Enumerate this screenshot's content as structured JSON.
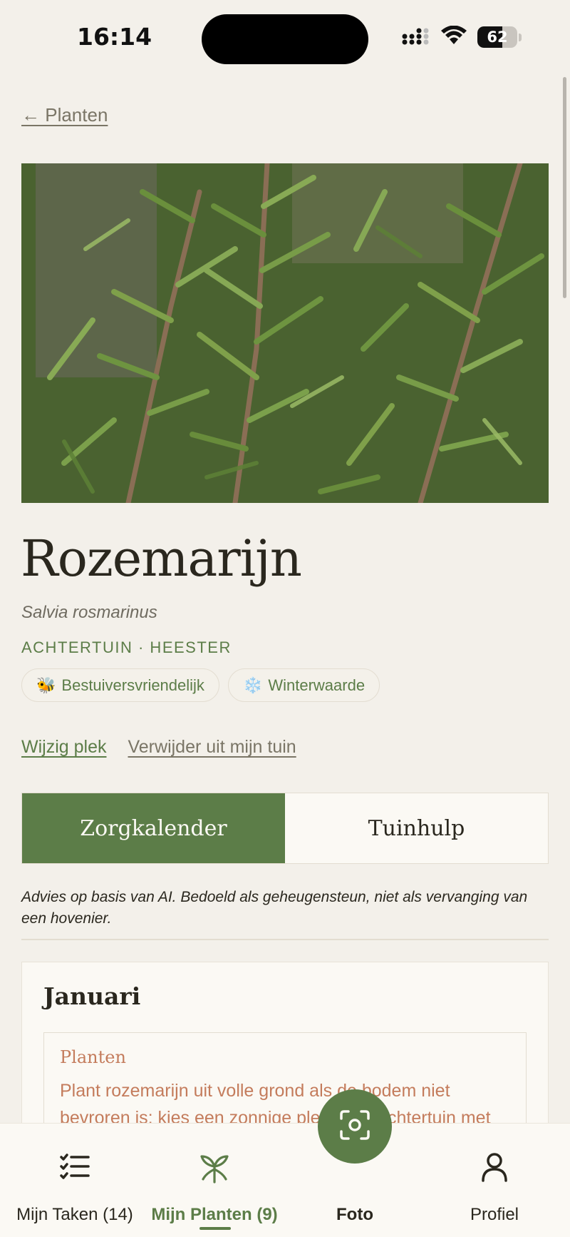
{
  "status_bar": {
    "time": "16:14",
    "battery": "62",
    "battery_level": 0.62
  },
  "back_link": "← Planten",
  "plant": {
    "name": "Rozemarijn",
    "latin_name": "Salvia rosmarinus",
    "meta": "ACHTERTUIN · HEESTER",
    "tags": [
      {
        "icon": "bee-icon",
        "emoji": "🐝",
        "label": "Bestuiversvriendelijk"
      },
      {
        "icon": "snowflake-icon",
        "emoji": "❄️",
        "label": "Winterwaarde"
      }
    ]
  },
  "actions": {
    "edit": "Wijzig plek",
    "remove": "Verwijder uit mijn tuin"
  },
  "tabs": [
    {
      "label": "Zorgkalender",
      "active": true
    },
    {
      "label": "Tuinhulp",
      "active": false
    }
  ],
  "disclaimer": "Advies op basis van AI. Bedoeld als geheugensteun, niet als vervanging van een hovenier.",
  "calendar": {
    "month": "Januari",
    "task": {
      "type": "Planten",
      "text": "Plant rozemarijn uit volle grond als de bodem niet bevroren is; kies een zonnige plek in de achtertuin met"
    }
  },
  "bottom_nav": [
    {
      "label": "Mijn Taken (14)",
      "icon": "task-list-icon",
      "active": false
    },
    {
      "label": "Mijn Planten (9)",
      "icon": "plant-icon",
      "active": true
    },
    {
      "label": "Foto",
      "icon": "camera-scan-icon",
      "active": false
    },
    {
      "label": "Profiel",
      "icon": "profile-icon",
      "active": false
    }
  ],
  "colors": {
    "accent": "#5c7d48",
    "background": "#f3f0ea",
    "task": "#c47c5c"
  }
}
